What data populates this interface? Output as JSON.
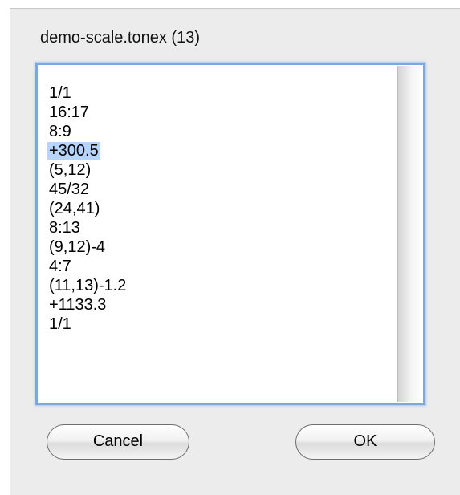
{
  "dialog": {
    "title": "demo-scale.tonex (13)"
  },
  "list": {
    "selected_index": 3,
    "items": [
      "1/1",
      "16:17",
      "8:9",
      "+300.5",
      "(5,12)",
      "45/32",
      "(24,41)",
      "8:13",
      "(9,12)-4",
      "4:7",
      "(11,13)-1.2",
      "+1133.3",
      "1/1"
    ]
  },
  "buttons": {
    "cancel_label": "Cancel",
    "ok_label": "OK"
  },
  "colors": {
    "selection_highlight": "#b5d5ff",
    "focus_ring": "#7fa7d9",
    "dialog_background": "#ececec"
  }
}
